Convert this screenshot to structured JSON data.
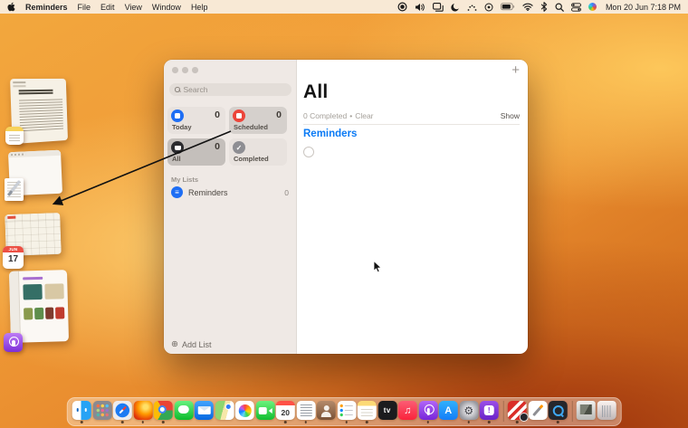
{
  "menu_bar": {
    "app_name": "Reminders",
    "menus": [
      "File",
      "Edit",
      "View",
      "Window",
      "Help"
    ],
    "status_icons": [
      {
        "name": "screen-recording-icon"
      },
      {
        "name": "volume-icon"
      },
      {
        "name": "stage-manager-icon"
      },
      {
        "name": "focus-moon-icon"
      },
      {
        "name": "keyboard-brightness-icon"
      },
      {
        "name": "timer-icon"
      },
      {
        "name": "battery-icon"
      },
      {
        "name": "wifi-icon"
      },
      {
        "name": "bluetooth-icon"
      },
      {
        "name": "spotlight-icon"
      },
      {
        "name": "control-center-icon"
      },
      {
        "name": "siri-icon"
      }
    ],
    "clock": "Mon 20 Jun 7:18 PM"
  },
  "stage_manager": {
    "thumbnails": [
      {
        "name": "notes-window-thumbnail",
        "app": "Notes"
      },
      {
        "name": "textedit-window-thumbnail",
        "app": "TextEdit"
      },
      {
        "name": "calendar-window-thumbnail",
        "app": "Calendar",
        "badge_month": "JUN",
        "badge_day": "17"
      },
      {
        "name": "podcasts-window-thumbnail",
        "app": "Podcasts"
      }
    ]
  },
  "window": {
    "sidebar": {
      "search_placeholder": "Search",
      "smart_lists": [
        {
          "label": "Today",
          "count": "0",
          "icon": "today-calendar-icon",
          "color": "#1E6EF4",
          "state": "normal"
        },
        {
          "label": "Scheduled",
          "count": "0",
          "icon": "scheduled-calendar-icon",
          "color": "#EC453A",
          "state": "hover"
        },
        {
          "label": "All",
          "count": "0",
          "icon": "all-tray-icon",
          "color": "#2B2B2E",
          "state": "selected"
        },
        {
          "label": "Completed",
          "count": "",
          "icon": "completed-check-icon",
          "color": "#8E8E93",
          "state": "normal"
        }
      ],
      "my_lists_label": "My Lists",
      "lists": [
        {
          "label": "Reminders",
          "count": "0",
          "icon": "list-bullets-icon",
          "color": "#1E6EF4"
        }
      ],
      "add_list_label": "Add List"
    },
    "content": {
      "add_reminder_label": "+",
      "title": "All",
      "completed_count_label": "0 Completed",
      "dot_separator": "•",
      "clear_label": "Clear",
      "show_label": "Show",
      "group_header": "Reminders"
    }
  },
  "dock": {
    "items": [
      {
        "name": "finder",
        "running": true
      },
      {
        "name": "launchpad",
        "running": false
      },
      {
        "name": "safari",
        "running": true
      },
      {
        "name": "firefox",
        "running": true
      },
      {
        "name": "chrome",
        "running": true
      },
      {
        "name": "messages",
        "running": false
      },
      {
        "name": "mail",
        "running": false
      },
      {
        "name": "maps",
        "running": false
      },
      {
        "name": "photos",
        "running": false
      },
      {
        "name": "facetime",
        "running": false
      },
      {
        "name": "calendar",
        "glyph": "20",
        "running": true
      },
      {
        "name": "textedit",
        "running": true
      },
      {
        "name": "contacts",
        "running": false
      },
      {
        "name": "reminders",
        "running": true
      },
      {
        "name": "notes",
        "running": true
      },
      {
        "name": "tv",
        "glyph": "tv",
        "running": false
      },
      {
        "name": "music",
        "glyph": "♫",
        "running": false
      },
      {
        "name": "podcasts",
        "running": true
      },
      {
        "name": "appstore",
        "glyph": "A",
        "running": false
      },
      {
        "name": "settings",
        "glyph": "⚙",
        "running": true
      },
      {
        "name": "feedback",
        "glyph": "!",
        "running": true
      },
      {
        "name": "divider"
      },
      {
        "name": "parallels",
        "running": true
      },
      {
        "name": "pages",
        "running": false
      },
      {
        "name": "quicktime",
        "running": true
      },
      {
        "name": "divider"
      },
      {
        "name": "recent-file",
        "running": false
      },
      {
        "name": "trash",
        "running": false
      }
    ]
  },
  "colors": {
    "accent_blue": "#0A7AF5",
    "sidebar_bg": "#EFE9E5",
    "selected_card": "#C4BFBB",
    "wallpaper_orange": "#E78A2D"
  }
}
